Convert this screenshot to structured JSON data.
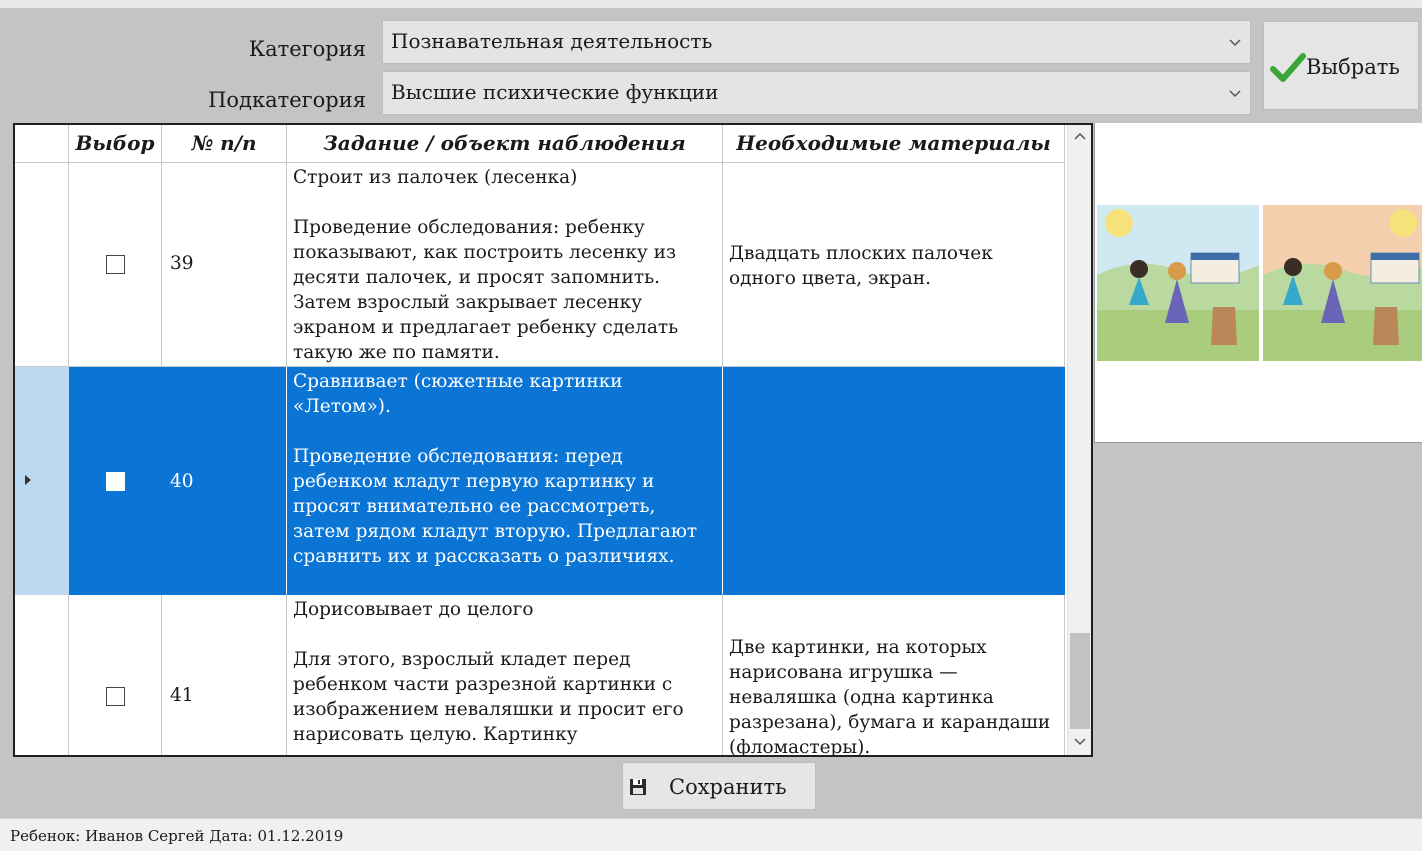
{
  "filters": {
    "category_label": "Категория",
    "category_value": "Познавательная деятельность",
    "subcategory_label": "Подкатегория",
    "subcategory_value": "Высшие психические функции",
    "select_button": "Выбрать"
  },
  "table": {
    "columns": [
      "Выбор",
      "№ п/п",
      "Задание / объект наблюдения",
      "Необходимые материалы"
    ],
    "rows": [
      {
        "checked": false,
        "num": "39",
        "task": "Строит из палочек (лесенка)\n\nПроведение обследования:  ребенку показывают, как построить лесенку из десяти палочек,  и просят запомнить. Затем взрослый закрывает лесенку экраном и предлагает ребенку сделать такую же по памяти.",
        "materials": "Двадцать  плоских  палочек одного цвета, экран."
      },
      {
        "checked": false,
        "num": "40",
        "task": "Сравнивает (сюжетные картинки «Летом»).\n\nПроведение обследования: перед ребенком кладут первую картинку и просят внимательно ее рассмотреть, затем рядом кладут вторую. Предлагают сравнить их и рассказать о различиях.",
        "materials": "",
        "selected": true
      },
      {
        "checked": false,
        "num": "41",
        "task": "Дорисовывает до целого\n\nДля этого, взрослый кладет перед ребенком части разрезной картинки с изображением неваляшки и просит его нарисовать целую. Картинку",
        "materials": "Две картинки, на которых нарисована игрушка — неваляшка (одна картинка разрезана), бумага и карандаши (фломастеры)."
      }
    ]
  },
  "save_button": "Сохранить",
  "status_bar": "Ребенок: Иванов Сергей Дата: 01.12.2019",
  "colors": {
    "selection": "#0b75d6",
    "panel_bg": "#c4c4c4",
    "check_green": "#3aa63a"
  },
  "icons": [
    "chevron-down-icon",
    "checkmark-icon",
    "save-disk-icon",
    "row-pointer-icon",
    "scroll-up-icon",
    "scroll-down-icon"
  ]
}
